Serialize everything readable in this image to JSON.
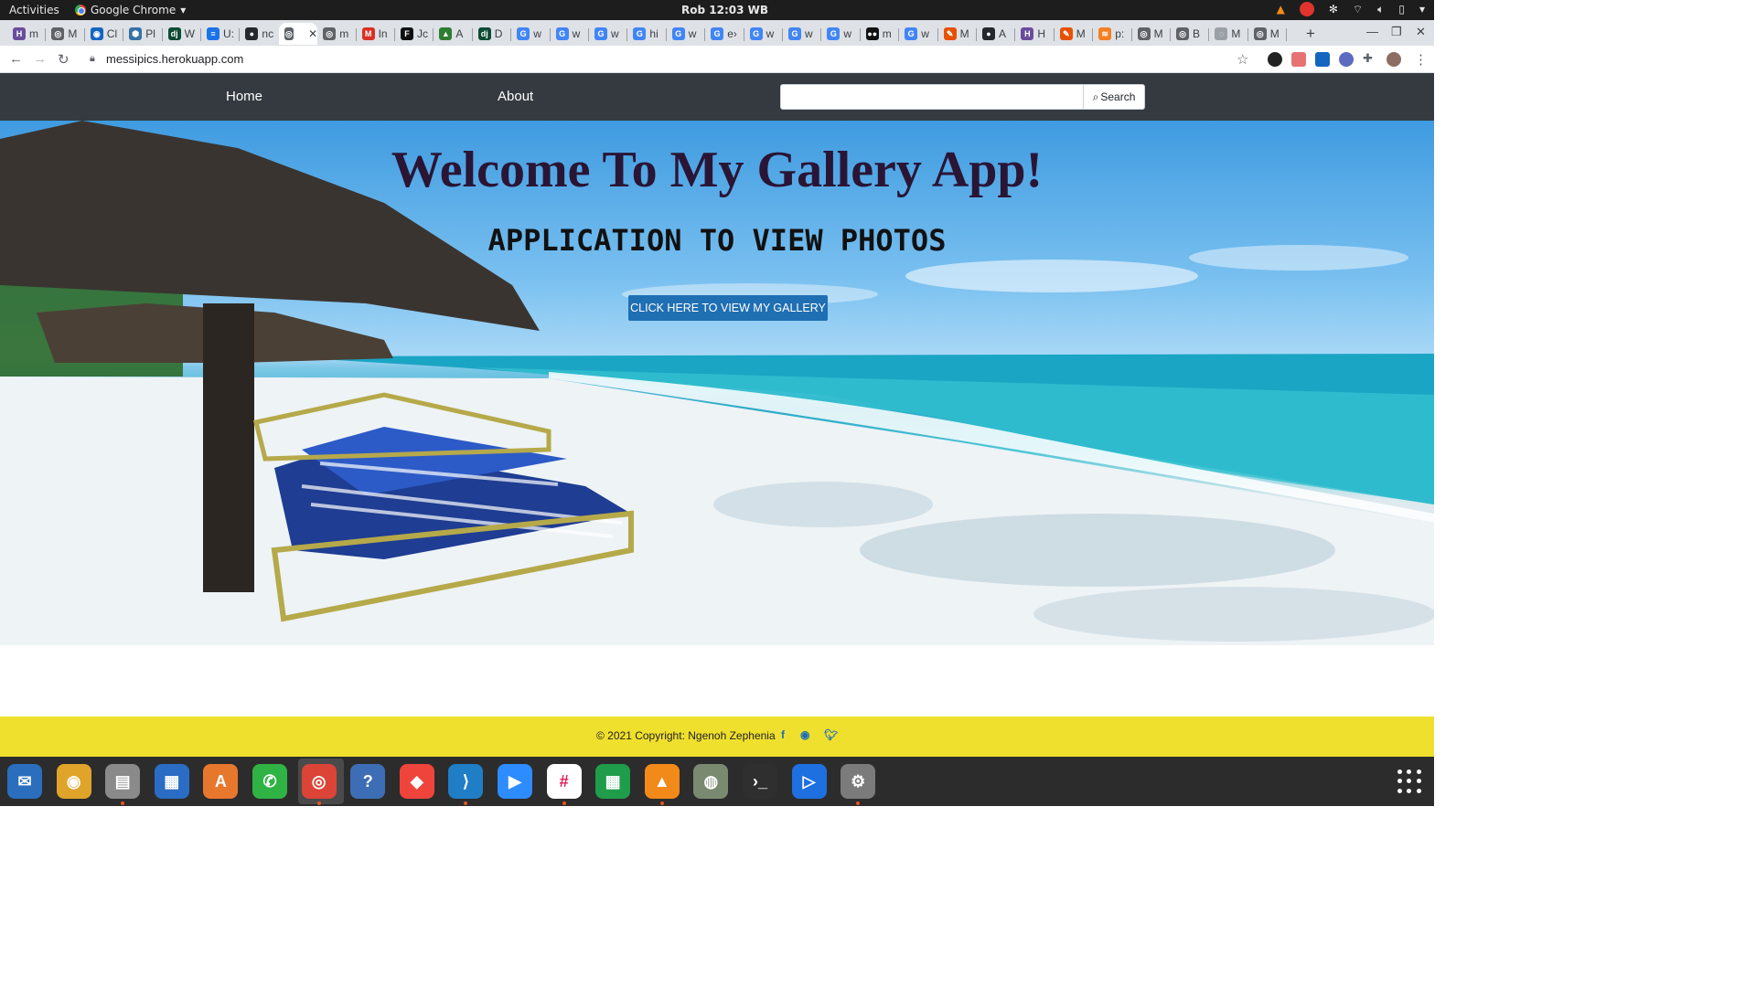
{
  "system": {
    "activities": "Activities",
    "app_name": "Google Chrome",
    "clock": "Rob 12:03 WB"
  },
  "browser": {
    "tabs": [
      {
        "icon": "H",
        "color": "#6a4c9c",
        "label": "m"
      },
      {
        "icon": "◎",
        "color": "#5f6368",
        "label": "M"
      },
      {
        "icon": "◉",
        "color": "#1565c0",
        "label": "Cl"
      },
      {
        "icon": "⬢",
        "color": "#3572a5",
        "label": "Pl"
      },
      {
        "icon": "dj",
        "color": "#0c4b33",
        "label": "W"
      },
      {
        "icon": "≡",
        "color": "#1a73e8",
        "label": "U:"
      },
      {
        "icon": "●",
        "color": "#24292e",
        "label": "nc"
      },
      {
        "icon": "◎",
        "color": "#5f6368",
        "label": ""
      },
      {
        "icon": "◎",
        "color": "#5f6368",
        "label": "m"
      },
      {
        "icon": "M",
        "color": "#d93025",
        "label": "In"
      },
      {
        "icon": "F",
        "color": "#111",
        "label": "Jc"
      },
      {
        "icon": "▲",
        "color": "#2e7d32",
        "label": "A"
      },
      {
        "icon": "dj",
        "color": "#0c4b33",
        "label": "D"
      },
      {
        "icon": "G",
        "color": "#4285f4",
        "label": "w"
      },
      {
        "icon": "G",
        "color": "#4285f4",
        "label": "w"
      },
      {
        "icon": "G",
        "color": "#4285f4",
        "label": "w"
      },
      {
        "icon": "G",
        "color": "#4285f4",
        "label": "hi"
      },
      {
        "icon": "G",
        "color": "#4285f4",
        "label": "w"
      },
      {
        "icon": "G",
        "color": "#4285f4",
        "label": "e›"
      },
      {
        "icon": "G",
        "color": "#4285f4",
        "label": "w"
      },
      {
        "icon": "G",
        "color": "#4285f4",
        "label": "w"
      },
      {
        "icon": "G",
        "color": "#4285f4",
        "label": "w"
      },
      {
        "icon": "●●",
        "color": "#111",
        "label": "m"
      },
      {
        "icon": "G",
        "color": "#4285f4",
        "label": "w"
      },
      {
        "icon": "✎",
        "color": "#e65100",
        "label": "M"
      },
      {
        "icon": "●",
        "color": "#24292e",
        "label": "A"
      },
      {
        "icon": "H",
        "color": "#6a4c9c",
        "label": "H"
      },
      {
        "icon": "✎",
        "color": "#e65100",
        "label": "M"
      },
      {
        "icon": "≋",
        "color": "#f48024",
        "label": "p:"
      },
      {
        "icon": "◎",
        "color": "#5f6368",
        "label": "M"
      },
      {
        "icon": "◎",
        "color": "#5f6368",
        "label": "B"
      },
      {
        "icon": "◌",
        "color": "#9aa0a6",
        "label": "M"
      },
      {
        "icon": "◎",
        "color": "#5f6368",
        "label": "M"
      }
    ],
    "url": "messipics.herokuapp.com"
  },
  "site": {
    "nav": {
      "home": "Home",
      "about": "About"
    },
    "search": {
      "placeholder": "",
      "button_label": "Search"
    },
    "hero": {
      "title": "Welcome To My Gallery App!",
      "subtitle": "APPLICATION TO VIEW PHOTOS",
      "cta_label": "CLICK HERE TO VIEW MY GALLERY"
    },
    "footer": {
      "copyright": "© 2021 Copyright: Ngenoh Zephenia",
      "social": [
        "facebook-icon",
        "github-icon",
        "twitter-icon"
      ]
    },
    "colors": {
      "navbar": "#343a40",
      "cta": "#1f6fb3",
      "footer": "#f0e02e"
    }
  },
  "dock": {
    "apps": [
      {
        "name": "thunderbird-icon",
        "glyph": "✉",
        "color": "#2a6ebd"
      },
      {
        "name": "rhythmbox-icon",
        "glyph": "◉",
        "color": "#e0a42a"
      },
      {
        "name": "files-icon",
        "glyph": "▤",
        "color": "#8a8a8a"
      },
      {
        "name": "writer-icon",
        "glyph": "▦",
        "color": "#2b6cc4"
      },
      {
        "name": "software-icon",
        "glyph": "A",
        "color": "#e8772e"
      },
      {
        "name": "whatsapp-icon",
        "glyph": "✆",
        "color": "#2fb344"
      },
      {
        "name": "chrome-icon",
        "glyph": "◎",
        "color": "#db4437"
      },
      {
        "name": "help-icon",
        "glyph": "?",
        "color": "#3d6db5"
      },
      {
        "name": "anydesk-icon",
        "glyph": "◆",
        "color": "#ef443b"
      },
      {
        "name": "vscode-icon",
        "glyph": "⟩",
        "color": "#1f7ec5"
      },
      {
        "name": "zoom-icon",
        "glyph": "▶",
        "color": "#2d8cff"
      },
      {
        "name": "slack-icon",
        "glyph": "#",
        "color": "#ffffff"
      },
      {
        "name": "calc-icon",
        "glyph": "▦",
        "color": "#1f9d4a"
      },
      {
        "name": "vlc-icon",
        "glyph": "▲",
        "color": "#f28a1a"
      },
      {
        "name": "image-viewer-icon",
        "glyph": "◍",
        "color": "#7a8a70"
      },
      {
        "name": "terminal-icon",
        "glyph": "›_",
        "color": "#2f2f2f"
      },
      {
        "name": "media-player-icon",
        "glyph": "▷",
        "color": "#1e6fe0"
      },
      {
        "name": "settings-icon",
        "glyph": "⚙",
        "color": "#7b7b7b"
      }
    ]
  }
}
